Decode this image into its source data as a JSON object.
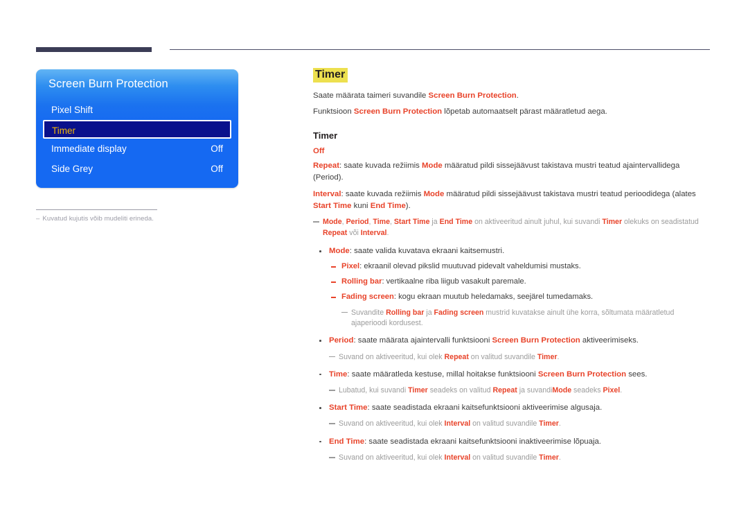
{
  "header": {
    "left_bar": "decorative-bar",
    "right_rule": "decorative-rule"
  },
  "osd": {
    "title": "Screen Burn Protection",
    "rows": [
      {
        "label": "Pixel Shift",
        "value": "",
        "selected": false
      },
      {
        "label": "Timer",
        "value": "",
        "selected": true
      },
      {
        "label": "Immediate display",
        "value": "Off",
        "selected": false
      },
      {
        "label": "Side Grey",
        "value": "Off",
        "selected": false
      }
    ],
    "footnote_dash": "–",
    "footnote": "Kuvatud kujutis võib mudeliti erineda."
  },
  "doc": {
    "title": "Timer",
    "intro1": {
      "a": "Saate määrata taimeri suvandile ",
      "term": "Screen Burn Protection",
      "b": "."
    },
    "intro2": {
      "a": "Funktsioon ",
      "term": "Screen Burn Protection",
      "b": " lõpetab automaatselt pärast määratletud aega."
    },
    "sub_head": "Timer",
    "option_off": "Off",
    "repeat": {
      "term": "Repeat",
      "a": ": saate kuvada režiimis ",
      "term2": "Mode",
      "b": " määratud pildi sissejäävust takistava mustri teatud ajaintervallidega (Period)."
    },
    "interval": {
      "term": "Interval",
      "a": ": saate kuvada režiimis ",
      "term2": "Mode",
      "b": " määratud pildi sissejäävust takistava mustri teatud perioodidega (alates ",
      "term3": "Start Time",
      "c": " kuni ",
      "term4": "End Time",
      "d": ")."
    },
    "note_activation": {
      "t1": "Mode",
      "s1": ", ",
      "t2": "Period",
      "s2": ", ",
      "t3": "Time",
      "s3": ", ",
      "t4": "Start Time",
      "s4": " ja ",
      "t5": "End Time",
      "s5": " on aktiveeritud ainult juhul, kui suvandi ",
      "t6": "Timer",
      "s6": " olekuks on seadistatud ",
      "t7": "Repeat",
      "s7": " või ",
      "t8": "Interval",
      "s8": "."
    },
    "bullets": [
      {
        "term": "Mode",
        "text": ": saate valida kuvatava ekraani kaitsemustri."
      },
      {
        "term": "Period",
        "text": ": saate määrata ajaintervalli funktsiooni ",
        "term2": "Screen Burn Protection",
        "text2": " aktiveerimiseks."
      },
      {
        "term": "Time",
        "text": ": saate määratleda kestuse, millal hoitakse funktsiooni ",
        "term2": "Screen Burn Protection",
        "text2": " sees."
      },
      {
        "term": "Start Time",
        "text": ": saate seadistada ekraani kaitsefunktsiooni aktiveerimise algusaja."
      },
      {
        "term": "End Time",
        "text": ": saate seadistada ekraani kaitsefunktsiooni inaktiveerimise lõpuaja."
      }
    ],
    "subbullets": [
      {
        "term": "Pixel",
        "text": ": ekraanil olevad pikslid muutuvad pidevalt vaheldumisi mustaks."
      },
      {
        "term": "Rolling bar",
        "text": ": vertikaalne riba liigub vasakult paremale."
      },
      {
        "term": "Fading screen",
        "text": ": kogu ekraan muutub heledamaks, seejärel tumedamaks."
      }
    ],
    "note_mode": {
      "a": "Suvandite ",
      "t1": "Rolling bar",
      "b": " ja ",
      "t2": "Fading screen",
      "c": " mustrid kuvatakse ainult ühe korra, sõltumata määratletud ajaperioodi kordusest."
    },
    "note_period": {
      "a": "Suvand on aktiveeritud, kui olek ",
      "t1": "Repeat",
      "b": " on valitud suvandile ",
      "t2": "Timer",
      "c": "."
    },
    "note_time": {
      "a": "Lubatud, kui suvandi ",
      "t1": "Timer",
      "b": " seadeks on valitud ",
      "t2": "Repeat",
      "c": " ja suvandi",
      "t3": "Mode",
      "d": " seadeks ",
      "t4": "Pixel",
      "e": "."
    },
    "note_start_time": {
      "a": "Suvand on aktiveeritud, kui olek ",
      "t1": "Interval",
      "b": " on valitud suvandile ",
      "t2": "Timer",
      "c": "."
    },
    "note_end_time": {
      "a": "Suvand on aktiveeritud, kui olek ",
      "t1": "Interval",
      "b": " on valitud suvandile ",
      "t2": "Timer",
      "c": "."
    }
  },
  "colors": {
    "accent_red": "#e8432a",
    "highlight_yellow": "#ede04f",
    "osd_blue": "#1569f2",
    "osd_selected": "#09118c",
    "osd_selected_text": "#f2b705",
    "note_grey": "#9b9b9b",
    "rule_navy": "#3b3c56"
  }
}
